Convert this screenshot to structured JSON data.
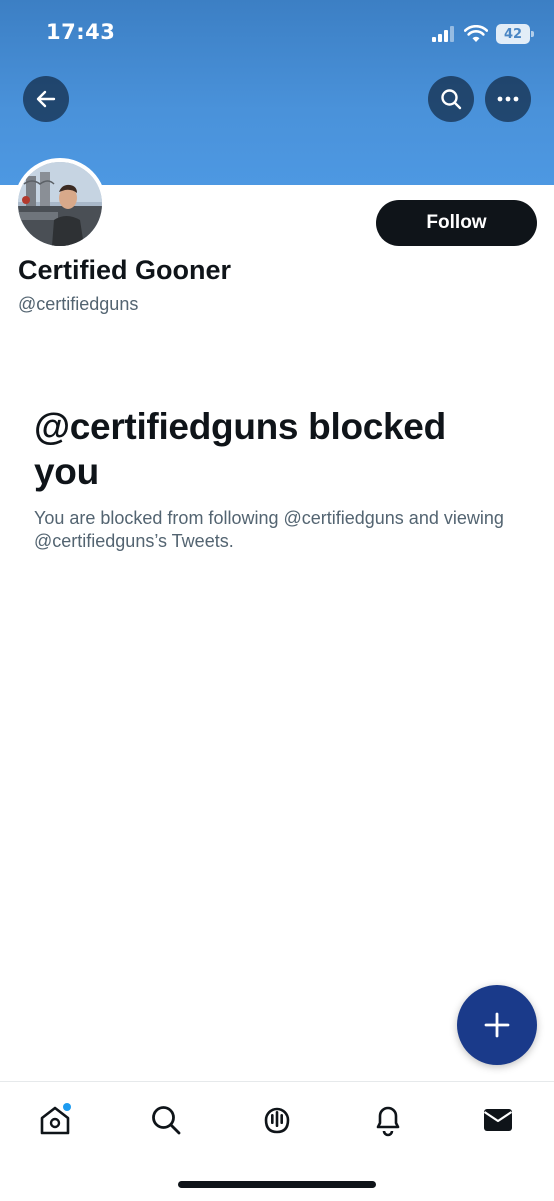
{
  "status_bar": {
    "time": "17:43",
    "battery": "42",
    "icons": [
      "signal-icon",
      "wifi-icon",
      "battery-icon"
    ]
  },
  "header": {
    "back_icon": "back-arrow-icon",
    "search_icon": "search-icon",
    "more_icon": "more-icon"
  },
  "profile": {
    "display_name": "Certified Gooner",
    "handle": "@certifiedguns",
    "follow_label": "Follow"
  },
  "blocked": {
    "title": "@certifiedguns blocked you",
    "description": "You are blocked from following @certifiedguns and viewing @certifiedguns’s Tweets."
  },
  "fab": {
    "icon": "plus-icon"
  },
  "bottom_nav": {
    "items": [
      {
        "icon": "home-icon",
        "has_badge": true
      },
      {
        "icon": "search-icon"
      },
      {
        "icon": "spaces-icon"
      },
      {
        "icon": "notifications-icon"
      },
      {
        "icon": "messages-icon"
      }
    ]
  },
  "colors": {
    "banner": "#4a92da",
    "text_primary": "#0f1419",
    "text_secondary": "#536471",
    "fab": "#1a3a8a",
    "badge": "#1d9bf0"
  }
}
